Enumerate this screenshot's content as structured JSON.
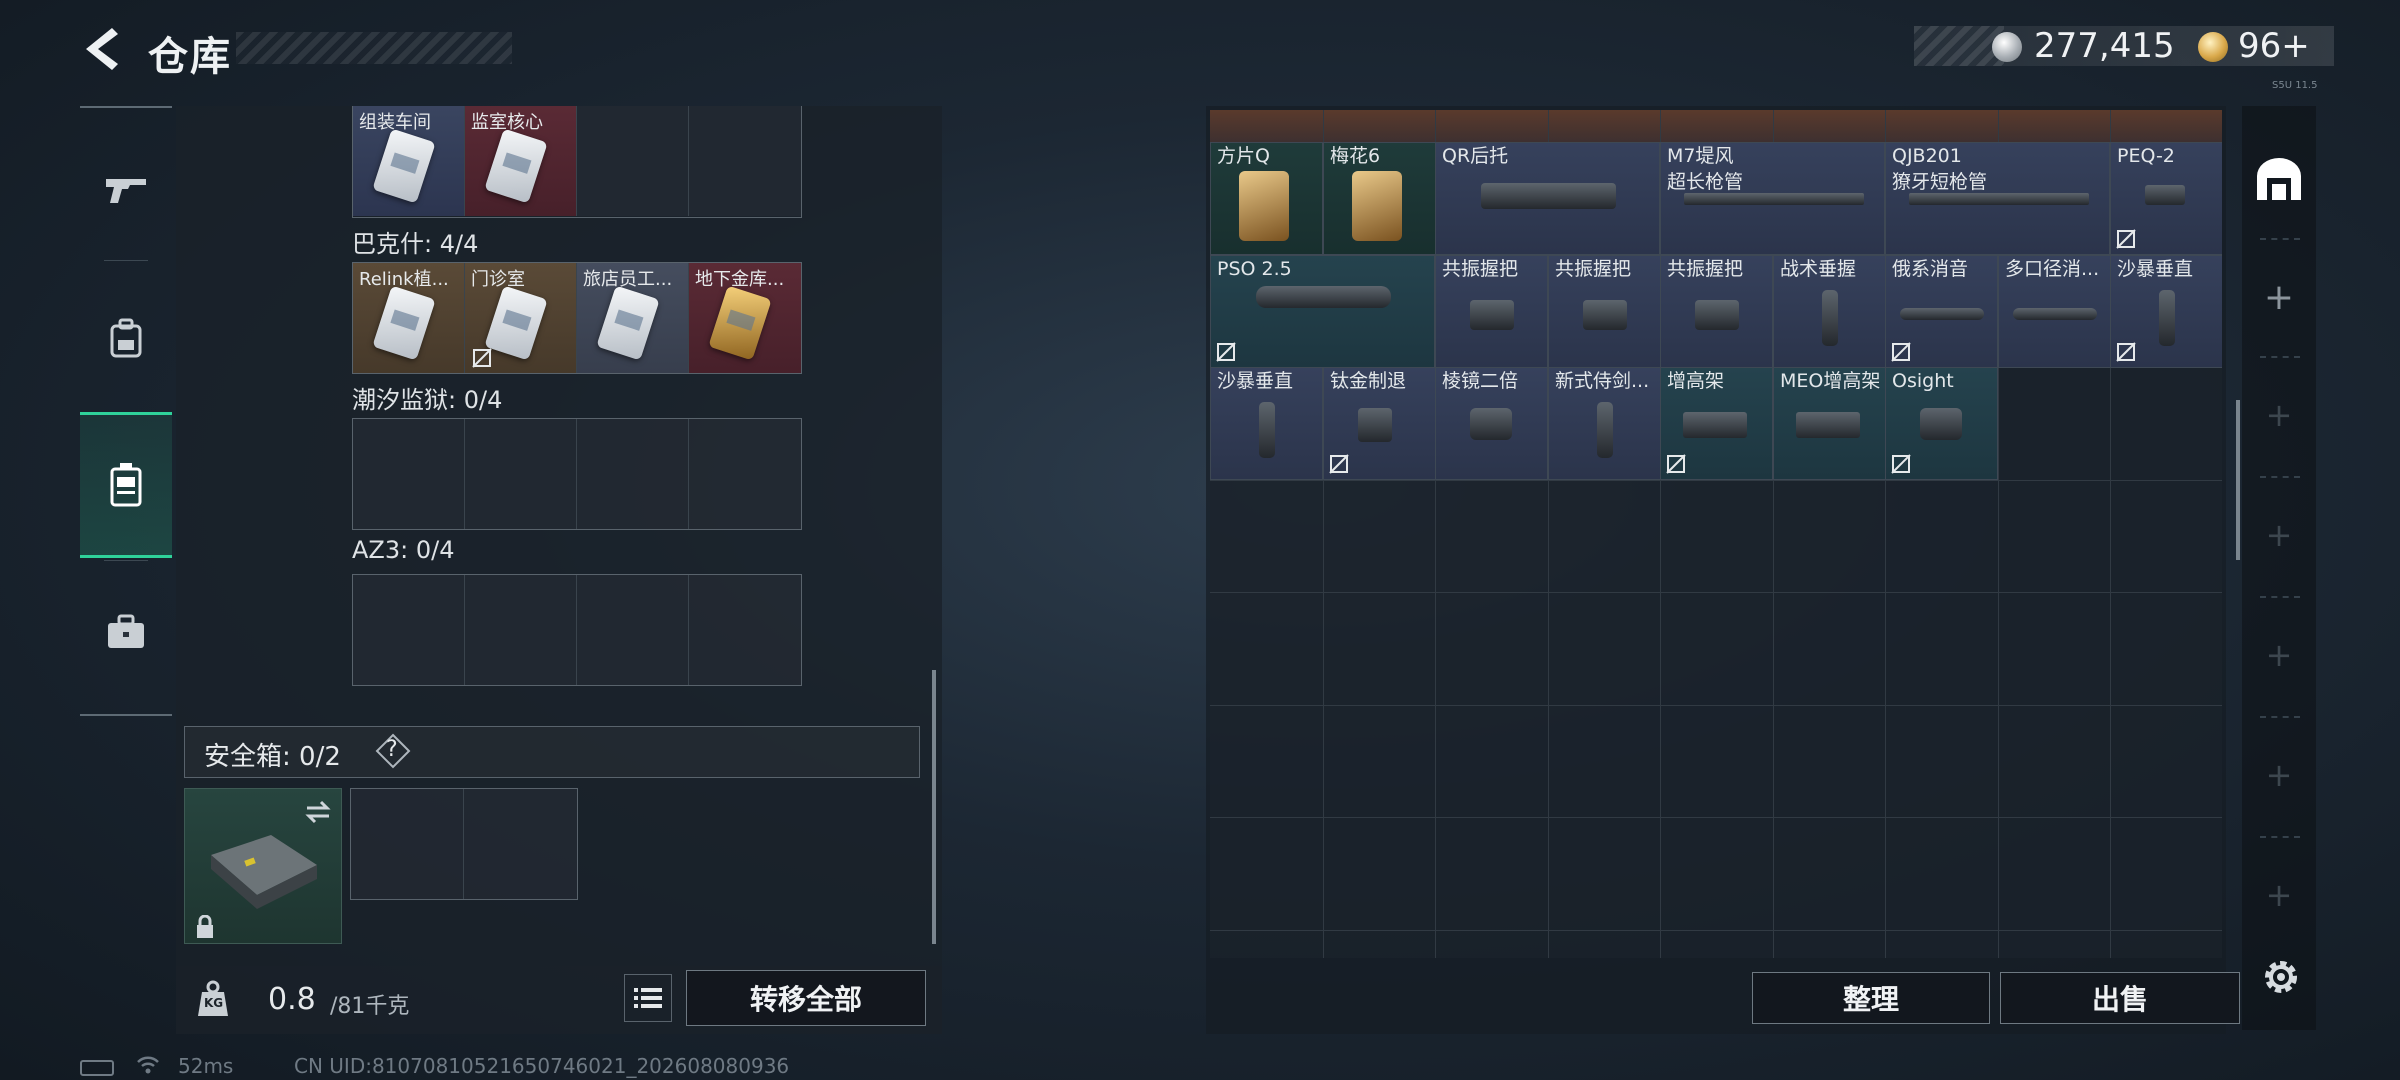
{
  "header": {
    "title": "仓库",
    "silver_amount": "277,415",
    "gold_amount": "96+",
    "version_tiny": "S5U 11.5"
  },
  "left_nav": {
    "items": [
      {
        "icon": "gun-icon"
      },
      {
        "icon": "backpack-icon"
      },
      {
        "icon": "storage-icon",
        "active": true
      },
      {
        "icon": "briefcase-icon"
      }
    ]
  },
  "collection": {
    "top_row": [
      {
        "name": "组装车间",
        "color": "blue"
      },
      {
        "name": "监室核心",
        "color": "red"
      },
      {
        "name": "",
        "color": "empty"
      },
      {
        "name": "",
        "color": "empty"
      }
    ],
    "sections": [
      {
        "label": "巴克什: 4/4",
        "slots": [
          {
            "name": "Relink植...",
            "color": "tan",
            "card": "white"
          },
          {
            "name": "门诊室",
            "color": "tan",
            "card": "white",
            "no_trade": true
          },
          {
            "name": "旅店员工...",
            "color": "gray",
            "card": "white"
          },
          {
            "name": "地下金库...",
            "color": "red",
            "card": "gold"
          }
        ]
      },
      {
        "label": "潮汐监狱: 0/4",
        "slots": []
      },
      {
        "label": "AZ3: 0/4",
        "slots": []
      }
    ]
  },
  "safe_box": {
    "label": "安全箱: 0/2",
    "help": "?"
  },
  "weight": {
    "value": "0.8",
    "unit": "/81千克",
    "kg_label": "KG"
  },
  "buttons": {
    "transfer_all": "转移全部",
    "sort": "整理",
    "sell": "出售"
  },
  "inventory": {
    "items": [
      {
        "name": "方片Q",
        "name2": "",
        "color": "dteal"
      },
      {
        "name": "梅花6",
        "name2": "",
        "color": "dteal"
      },
      {
        "name": "QR后托",
        "name2": "",
        "color": "blue"
      },
      {
        "name": "M7堤风",
        "name2": "超长枪管",
        "color": "blue"
      },
      {
        "name": "QJB201",
        "name2": "獠牙短枪管",
        "color": "blue"
      },
      {
        "name": "PEQ-2",
        "name2": "",
        "color": "blue"
      },
      {
        "name": "PSO 2.5",
        "name2": "",
        "color": "teal"
      },
      {
        "name": "共振握把",
        "name2": "",
        "color": "blue"
      },
      {
        "name": "共振握把",
        "name2": "",
        "color": "blue"
      },
      {
        "name": "共振握把",
        "name2": "",
        "color": "blue"
      },
      {
        "name": "战术垂握",
        "name2": "",
        "color": "blue"
      },
      {
        "name": "俄系消音",
        "name2": "",
        "color": "blue"
      },
      {
        "name": "多口径消...",
        "name2": "",
        "color": "blue"
      },
      {
        "name": "沙暴垂直",
        "name2": "",
        "color": "blue"
      },
      {
        "name": "沙暴垂直",
        "name2": "",
        "color": "blue"
      },
      {
        "name": "钛金制退",
        "name2": "",
        "color": "blue"
      },
      {
        "name": "棱镜二倍",
        "name2": "",
        "color": "blue"
      },
      {
        "name": "新式侍剑...",
        "name2": "",
        "color": "blue"
      },
      {
        "name": "增高架",
        "name2": "",
        "color": "teal"
      },
      {
        "name": "MEO增高架",
        "name2": "",
        "color": "teal"
      },
      {
        "name": "Osight",
        "name2": "",
        "color": "teal"
      }
    ]
  },
  "status": {
    "ping": "52ms",
    "uid": "CN UID:81070810521650746021_202608080936"
  },
  "colors": {
    "accent": "#2fd29a",
    "rarity_blue": "#36415c",
    "rarity_teal": "#25434e",
    "rarity_red": "#5a2a35",
    "rarity_tan": "#5a4a37"
  }
}
